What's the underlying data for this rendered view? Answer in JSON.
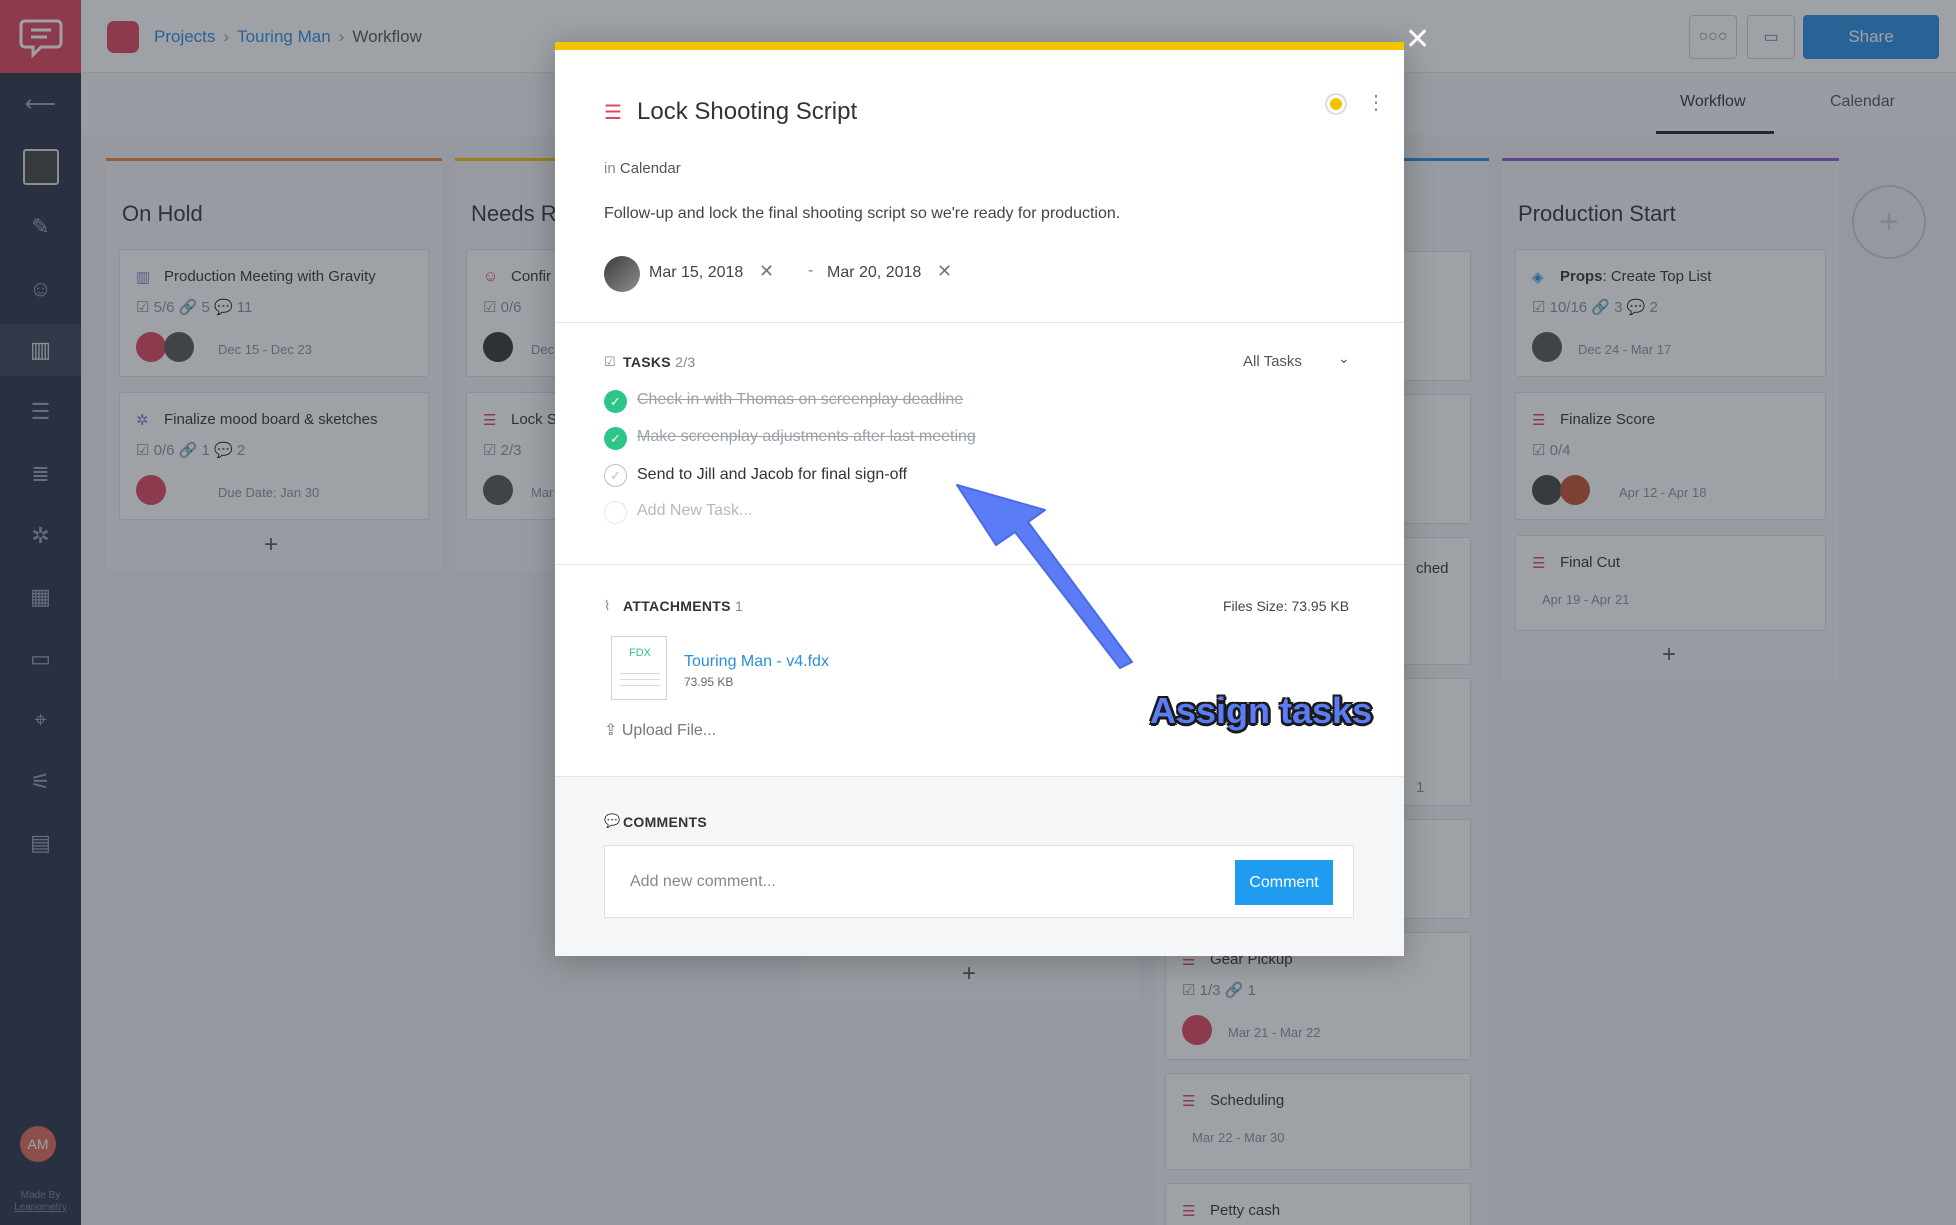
{
  "app": {
    "made_by": "Made By",
    "made_by_company": "Leanometry",
    "user_initials": "AM"
  },
  "breadcrumb": [
    "Projects",
    "Touring Man",
    "Workflow"
  ],
  "toolbar": {
    "share_label": "Share"
  },
  "view_tabs": [
    {
      "label": "Workflow",
      "active": true
    },
    {
      "label": "Calendar",
      "active": false
    }
  ],
  "columns": [
    {
      "title": "On Hold",
      "accent": "#f0883a",
      "cards": [
        {
          "title": "Production Meeting with Gravity",
          "meta": "☑ 5/6  🔗 5  💬 11",
          "date": "Dec 15 - Dec 23"
        },
        {
          "title": "Finalize mood board & sketches",
          "meta": "☑ 0/6  🔗 1  💬 2",
          "date": "Due Date: Jan 30"
        }
      ]
    },
    {
      "title": "Needs R",
      "accent": "#f5c300",
      "cards": [
        {
          "title": "Confir",
          "meta": "☑ 0/6",
          "date": "Dec"
        },
        {
          "title": "Lock S",
          "meta": "☑ 2/3",
          "date": "Mar"
        }
      ]
    },
    {
      "title": "Production Start",
      "accent": "#8a5bd6",
      "cards": [
        {
          "title_bold": "Props",
          "title": ": Create Top List",
          "meta": "☑ 10/16  🔗 3  💬 2",
          "date": "Dec 24 - Mar 17"
        },
        {
          "title": "Finalize Score",
          "meta": "☑ 0/4",
          "date": "Apr 12 - Apr 18"
        },
        {
          "title": "Final Cut",
          "meta": "",
          "date": "Apr 19 - Apr 21"
        }
      ]
    }
  ],
  "right_column_cards": [
    {
      "title": "Gear Pickup",
      "meta": "☑ 1/3  🔗 1",
      "date": "Mar 21 - Mar 22"
    },
    {
      "title": "Scheduling",
      "date": "Mar 22 - Mar 30"
    },
    {
      "title": "Petty cash"
    }
  ],
  "partial_texts": {
    "ched": "ched",
    "one": "1"
  },
  "modal": {
    "title": "Lock Shooting Script",
    "in_prefix": "in",
    "in_list": "Calendar",
    "description": "Follow-up and lock the final shooting script so we're ready for production.",
    "start_date": "Mar 15, 2018",
    "end_date": "Mar 20, 2018",
    "date_separator": "-",
    "status_color": "#f5c300",
    "tasks_header": "TASKS",
    "tasks_count": "2/3",
    "tasks_filter": "All Tasks",
    "tasks": [
      {
        "label": "Check in with Thomas on screenplay deadline",
        "done": true
      },
      {
        "label": "Make screenplay adjustments after last meeting",
        "done": true
      },
      {
        "label": "Send to Jill and Jacob for final sign-off",
        "done": false
      }
    ],
    "new_task_placeholder": "Add New Task...",
    "attachments_header": "ATTACHMENTS",
    "attachments_count": "1",
    "files_size": "Files Size: 73.95 KB",
    "attachment": {
      "type_label": "FDX",
      "name": "Touring Man - v4.fdx",
      "size": "73.95 KB"
    },
    "upload_label": "Upload File...",
    "comments_header": "COMMENTS",
    "comment_placeholder": "Add new comment...",
    "comment_button": "Comment"
  },
  "annotation": {
    "text": "Assign tasks",
    "color": "#5b7cf5"
  }
}
